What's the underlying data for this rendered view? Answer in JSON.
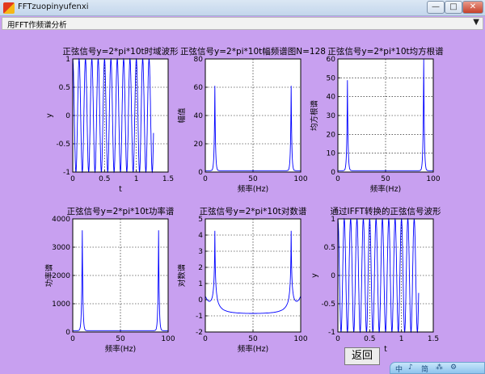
{
  "window": {
    "title": "FFTzuopinyufenxi",
    "minimize": "—",
    "maximize": "□",
    "close": "✕"
  },
  "menu": {
    "label": "用FFT作频谱分析",
    "arrow": "▼"
  },
  "back_button": "返回",
  "ime": [
    "中",
    "♪",
    "简",
    "⁂",
    "⚙"
  ],
  "colors": {
    "background": "#c8a0f0",
    "signal": "#0000ff",
    "grid": "#000000"
  },
  "chart_data": [
    {
      "type": "line",
      "title": "正弦信号y=2*pi*10t时域波形",
      "xlabel": "t",
      "ylabel": "y",
      "xlim": [
        0,
        1.5
      ],
      "ylim": [
        -1,
        1
      ],
      "xticks": [
        "0",
        "0.5",
        "1",
        "1.5"
      ],
      "yticks": [
        "-1",
        "-0.5",
        "0",
        "0.5",
        "1"
      ],
      "signal": {
        "kind": "sine",
        "frequency": 10,
        "t_end": 1.27
      },
      "grid": true
    },
    {
      "type": "line",
      "title": "正弦信号y=2*pi*10t幅频谱图N=128",
      "xlabel": "频率(Hz)",
      "ylabel": "幅值",
      "xlim": [
        0,
        100
      ],
      "ylim": [
        0,
        80
      ],
      "xticks": [
        "0",
        "50",
        "100"
      ],
      "yticks": [
        "0",
        "20",
        "40",
        "60",
        "80"
      ],
      "peaks": [
        {
          "x": 10,
          "y": 60
        },
        {
          "x": 90,
          "y": 60
        }
      ],
      "grid": true
    },
    {
      "type": "line",
      "title": "正弦信号y=2*pi*10t均方根谱",
      "xlabel": "频率(Hz)",
      "ylabel": "均方根谱",
      "xlim": [
        0,
        100
      ],
      "ylim": [
        0,
        60
      ],
      "xticks": [
        "0",
        "50",
        "100"
      ],
      "yticks": [
        "0",
        "10",
        "20",
        "30",
        "40",
        "50",
        "60"
      ],
      "peaks": [
        {
          "x": 10,
          "y": 48
        },
        {
          "x": 90,
          "y": 60
        }
      ],
      "grid": true
    },
    {
      "type": "line",
      "title": "正弦信号y=2*pi*10t功率谱",
      "xlabel": "频率(Hz)",
      "ylabel": "功率谱",
      "xlim": [
        0,
        100
      ],
      "ylim": [
        0,
        4000
      ],
      "xticks": [
        "0",
        "50",
        "100"
      ],
      "yticks": [
        "0",
        "1000",
        "2000",
        "3000",
        "4000"
      ],
      "peaks": [
        {
          "x": 10,
          "y": 3550
        },
        {
          "x": 90,
          "y": 3550
        }
      ],
      "grid": true
    },
    {
      "type": "line",
      "title": "正弦信号y=2*pi*10t对数谱",
      "xlabel": "频率(Hz)",
      "ylabel": "对数谱",
      "xlim": [
        0,
        100
      ],
      "ylim": [
        -2,
        5
      ],
      "xticks": [
        "0",
        "50",
        "100"
      ],
      "yticks": [
        "-2",
        "-1",
        "0",
        "1",
        "2",
        "3",
        "4",
        "5"
      ],
      "peaks": [
        {
          "x": 10,
          "y": 4.1
        },
        {
          "x": 90,
          "y": 4.1
        }
      ],
      "floor": -1,
      "grid": true
    },
    {
      "type": "line",
      "title": "通过IFFT转换的正弦信号波形",
      "xlabel": "t",
      "ylabel": "y",
      "xlim": [
        0,
        1.5
      ],
      "ylim": [
        -1,
        1
      ],
      "xticks": [
        "0",
        "0.5",
        "1",
        "1.5"
      ],
      "yticks": [
        "-1",
        "-0.5",
        "0",
        "0.5",
        "1"
      ],
      "signal": {
        "kind": "sine",
        "frequency": 10,
        "t_end": 1.27
      },
      "grid": true
    }
  ]
}
